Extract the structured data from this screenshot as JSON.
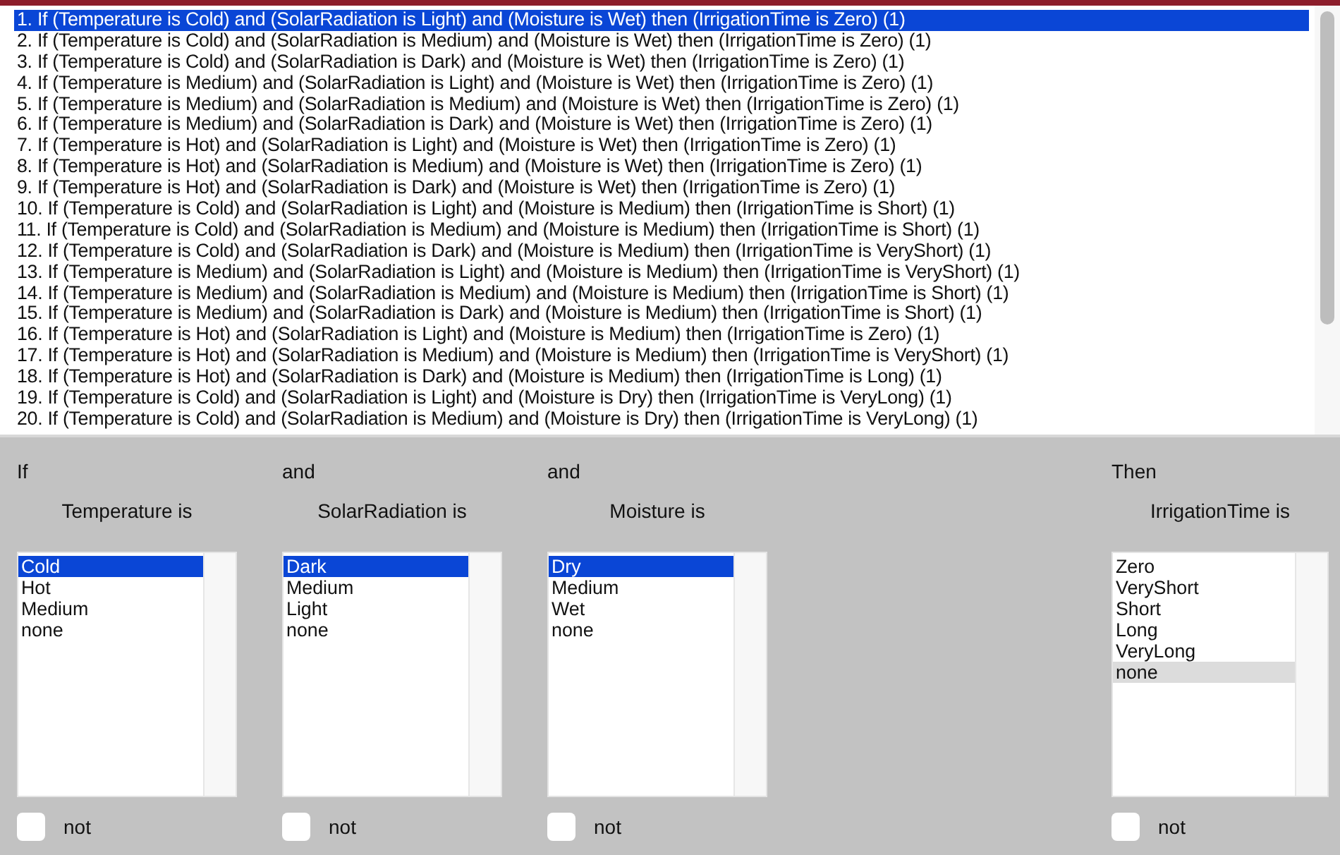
{
  "rules": [
    {
      "text": "1. If (Temperature is Cold) and (SolarRadiation is Light) and (Moisture is Wet) then (IrrigationTime is Zero) (1)",
      "selected": true
    },
    {
      "text": "2. If (Temperature is Cold) and (SolarRadiation is Medium) and (Moisture is Wet) then (IrrigationTime is Zero) (1)",
      "selected": false
    },
    {
      "text": "3. If (Temperature is Cold) and (SolarRadiation is Dark) and (Moisture is Wet) then (IrrigationTime is Zero) (1)",
      "selected": false
    },
    {
      "text": "4. If (Temperature is Medium) and (SolarRadiation is Light) and (Moisture is Wet) then (IrrigationTime is Zero) (1)",
      "selected": false
    },
    {
      "text": "5. If (Temperature is Medium) and (SolarRadiation is Medium) and (Moisture is Wet) then (IrrigationTime is Zero) (1)",
      "selected": false
    },
    {
      "text": "6. If (Temperature is Medium) and (SolarRadiation is Dark) and (Moisture is Wet) then (IrrigationTime is Zero) (1)",
      "selected": false
    },
    {
      "text": "7. If (Temperature is Hot) and (SolarRadiation is Light) and (Moisture is Wet) then (IrrigationTime is Zero) (1)",
      "selected": false
    },
    {
      "text": "8. If (Temperature is Hot) and (SolarRadiation is Medium) and (Moisture is Wet) then (IrrigationTime is Zero) (1)",
      "selected": false
    },
    {
      "text": "9. If (Temperature is Hot) and (SolarRadiation is Dark) and (Moisture is Wet) then (IrrigationTime is Zero) (1)",
      "selected": false
    },
    {
      "text": "10. If (Temperature is Cold) and (SolarRadiation is Light) and (Moisture is Medium) then (IrrigationTime is Short) (1)",
      "selected": false
    },
    {
      "text": "11. If (Temperature is Cold) and (SolarRadiation is Medium) and (Moisture is Medium) then (IrrigationTime is Short) (1)",
      "selected": false
    },
    {
      "text": "12. If (Temperature is Cold) and (SolarRadiation is Dark) and (Moisture is Medium) then (IrrigationTime is VeryShort) (1)",
      "selected": false
    },
    {
      "text": "13. If (Temperature is Medium) and (SolarRadiation is Light) and (Moisture is Medium) then (IrrigationTime is VeryShort) (1)",
      "selected": false
    },
    {
      "text": "14. If (Temperature is Medium) and (SolarRadiation is Medium) and (Moisture is Medium) then (IrrigationTime is Short) (1)",
      "selected": false
    },
    {
      "text": "15. If (Temperature is Medium) and (SolarRadiation is Dark) and (Moisture is Medium) then (IrrigationTime is Short) (1)",
      "selected": false
    },
    {
      "text": "16. If (Temperature is Hot) and (SolarRadiation is Light) and (Moisture is Medium) then (IrrigationTime is Zero) (1)",
      "selected": false
    },
    {
      "text": "17. If (Temperature is Hot) and (SolarRadiation is Medium) and (Moisture is Medium) then (IrrigationTime is VeryShort) (1)",
      "selected": false
    },
    {
      "text": "18. If (Temperature is Hot) and (SolarRadiation is Dark) and (Moisture is Medium) then (IrrigationTime is Long) (1)",
      "selected": false
    },
    {
      "text": "19. If (Temperature is Cold) and (SolarRadiation is Light) and (Moisture is Dry) then (IrrigationTime is VeryLong) (1)",
      "selected": false
    },
    {
      "text": "20. If (Temperature is Cold) and (SolarRadiation is Medium) and (Moisture is Dry) then (IrrigationTime is VeryLong) (1)",
      "selected": false
    }
  ],
  "variables": [
    {
      "kind": "input",
      "connective": "If",
      "label": "Temperature is",
      "focused": true,
      "not_checked": false,
      "options": [
        {
          "text": "Cold",
          "selected": true
        },
        {
          "text": "Hot",
          "selected": false
        },
        {
          "text": "Medium",
          "selected": false
        },
        {
          "text": "none",
          "selected": false
        }
      ],
      "not_label": "not"
    },
    {
      "kind": "input",
      "connective": "and",
      "label": "SolarRadiation is",
      "focused": true,
      "not_checked": false,
      "options": [
        {
          "text": "Dark",
          "selected": true
        },
        {
          "text": "Medium",
          "selected": false
        },
        {
          "text": "Light",
          "selected": false
        },
        {
          "text": "none",
          "selected": false
        }
      ],
      "not_label": "not"
    },
    {
      "kind": "input",
      "connective": "and",
      "label": "Moisture is",
      "focused": true,
      "not_checked": false,
      "options": [
        {
          "text": "Dry",
          "selected": true
        },
        {
          "text": "Medium",
          "selected": false
        },
        {
          "text": "Wet",
          "selected": false
        },
        {
          "text": "none",
          "selected": false
        }
      ],
      "not_label": "not"
    },
    {
      "kind": "output",
      "connective": "Then",
      "label": "IrrigationTime is",
      "focused": false,
      "not_checked": false,
      "options": [
        {
          "text": "Zero",
          "selected": false
        },
        {
          "text": "VeryShort",
          "selected": false
        },
        {
          "text": "Short",
          "selected": false
        },
        {
          "text": "Long",
          "selected": false
        },
        {
          "text": "VeryLong",
          "selected": false
        },
        {
          "text": "none",
          "selected": true
        }
      ],
      "not_label": "not"
    }
  ]
}
